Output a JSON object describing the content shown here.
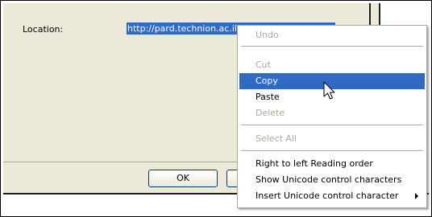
{
  "dialog": {
    "location_label": "Location:",
    "location_value": "http://pard.technion.ac.il/video/coler-mpg.mpg",
    "ok_label": "OK"
  },
  "context_menu": {
    "items": [
      {
        "label": "Undo",
        "enabled": false
      },
      {
        "label": "Cut",
        "enabled": false
      },
      {
        "label": "Copy",
        "enabled": true,
        "highlighted": true
      },
      {
        "label": "Paste",
        "enabled": true
      },
      {
        "label": "Delete",
        "enabled": false
      },
      {
        "label": "Select All",
        "enabled": false
      },
      {
        "label": "Right to left Reading order",
        "enabled": true
      },
      {
        "label": "Show Unicode control characters",
        "enabled": true
      },
      {
        "label": "Insert Unicode control character",
        "enabled": true,
        "submenu": true
      }
    ]
  },
  "colors": {
    "dialog_background": "#ece9d8",
    "selection": "#316ac5",
    "disabled_text": "#aca899"
  },
  "icons": {
    "cursor": "arrow-pointer-icon",
    "submenu": "chevron-right-icon"
  }
}
